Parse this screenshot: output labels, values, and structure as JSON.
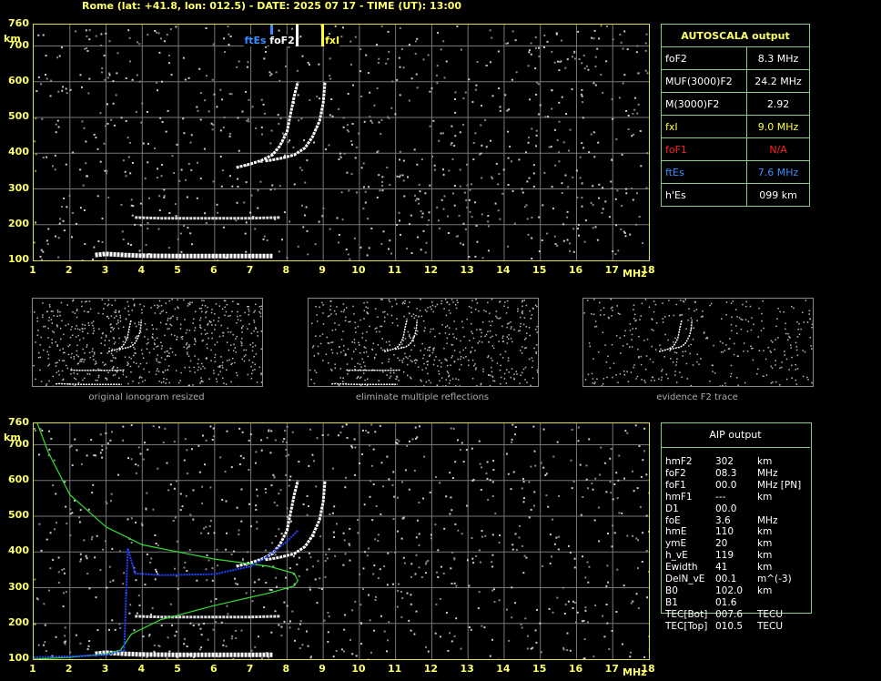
{
  "header": {
    "title": "Rome (lat: +41.8, lon: 012.5) - DATE: 2025 07 17 - TIME (UT): 13:00"
  },
  "axes": {
    "y_unit": "km",
    "y_ticks": [
      "760",
      "700",
      "600",
      "500",
      "400",
      "300",
      "200",
      "100"
    ],
    "x_unit": "MHz",
    "x_ticks": [
      "1",
      "2",
      "3",
      "4",
      "5",
      "6",
      "7",
      "8",
      "9",
      "10",
      "11",
      "12",
      "13",
      "14",
      "15",
      "16",
      "17",
      "18"
    ]
  },
  "markers": [
    {
      "label": "ftEs",
      "color": "#3a8cff",
      "freq": 7.6
    },
    {
      "label": "foF2",
      "color": "#ffffff",
      "freq": 8.3
    },
    {
      "label": "fxI",
      "color": "#ffff33",
      "freq": 9.0
    }
  ],
  "autoscala": {
    "title": "AUTOSCALA output",
    "rows": [
      {
        "name": "foF2",
        "value": "8.3 MHz",
        "color": "#ffffff"
      },
      {
        "name": "MUF(3000)F2",
        "value": "24.2 MHz",
        "color": "#ffffff"
      },
      {
        "name": "M(3000)F2",
        "value": "2.92",
        "color": "#ffffff"
      },
      {
        "name": "fxI",
        "value": "9.0 MHz",
        "color": "#ffff33"
      },
      {
        "name": "foF1",
        "value": "N/A",
        "color": "#ff2020"
      },
      {
        "name": "ftEs",
        "value": "7.6 MHz",
        "color": "#3a8cff"
      },
      {
        "name": "h'Es",
        "value": "099    km",
        "color": "#ffffff"
      }
    ]
  },
  "thumbnails": [
    {
      "caption": "original ionogram resized"
    },
    {
      "caption": "eliminate multiple reflections"
    },
    {
      "caption": "evidence F2 trace"
    }
  ],
  "aip": {
    "title": "AIP output",
    "rows": [
      {
        "name": "hmF2",
        "value": "302",
        "unit": "km"
      },
      {
        "name": "foF2",
        "value": "08.3",
        "unit": "MHz"
      },
      {
        "name": "foF1",
        "value": "00.0",
        "unit": "MHz   [PN]"
      },
      {
        "name": "hmF1",
        "value": "---",
        "unit": "km"
      },
      {
        "name": "D1",
        "value": "00.0",
        "unit": ""
      },
      {
        "name": "foE",
        "value": "3.6",
        "unit": "MHz"
      },
      {
        "name": "hmE",
        "value": "110",
        "unit": "km"
      },
      {
        "name": "ymE",
        "value": "20",
        "unit": "km"
      },
      {
        "name": "h_vE",
        "value": "119",
        "unit": "km"
      },
      {
        "name": "Ewidth",
        "value": "41",
        "unit": "km"
      },
      {
        "name": "DelN_vE",
        "value": "00.1",
        "unit": "m^(-3)"
      },
      {
        "name": "B0",
        "value": "102.0",
        "unit": "km"
      },
      {
        "name": "B1",
        "value": "01.6",
        "unit": ""
      },
      {
        "name": "TEC[Bot]",
        "value": "007.6",
        "unit": "TECU"
      },
      {
        "name": "TEC[Top]",
        "value": "010.5",
        "unit": "TECU"
      }
    ]
  },
  "chart_data": {
    "type": "scatter",
    "xlim": [
      1,
      18
    ],
    "ylim": [
      100,
      760
    ],
    "traces": {
      "es_trace": {
        "x": [
          2.7,
          3.0,
          3.5,
          4.0,
          5.0,
          6.0,
          7.0,
          7.6
        ],
        "y": [
          115,
          118,
          115,
          113,
          112,
          112,
          112,
          112
        ]
      },
      "e_second": {
        "x": [
          3.8,
          4.5,
          5.0,
          6.0,
          7.0,
          7.8
        ],
        "y": [
          220,
          218,
          218,
          218,
          218,
          220
        ]
      },
      "f2_o": {
        "x": [
          6.6,
          7.0,
          7.3,
          7.6,
          7.8,
          8.0,
          8.1,
          8.2,
          8.3
        ],
        "y": [
          360,
          370,
          380,
          395,
          420,
          460,
          510,
          560,
          600
        ]
      },
      "f2_x": {
        "x": [
          7.4,
          7.8,
          8.2,
          8.5,
          8.7,
          8.9,
          9.0,
          9.05
        ],
        "y": [
          378,
          385,
          395,
          415,
          445,
          490,
          540,
          600
        ]
      }
    },
    "profile": {
      "x": [
        1.0,
        2.0,
        3.0,
        3.4,
        3.5,
        3.7,
        4.5,
        6.0,
        7.5,
        8.2,
        8.3,
        8.2,
        7.5,
        6.0,
        5.0,
        4.0,
        3.0,
        2.0,
        1.4,
        1.1
      ],
      "y": [
        100,
        105,
        115,
        125,
        140,
        170,
        210,
        250,
        285,
        305,
        320,
        340,
        360,
        380,
        400,
        420,
        470,
        560,
        680,
        760
      ]
    },
    "true_height": {
      "x": [
        1.0,
        2.0,
        3.0,
        3.5,
        3.6,
        3.8,
        4.5,
        6.0,
        7.0,
        7.5,
        8.0,
        8.3
      ],
      "y": [
        105,
        108,
        112,
        125,
        410,
        340,
        335,
        338,
        360,
        390,
        430,
        460
      ]
    }
  }
}
